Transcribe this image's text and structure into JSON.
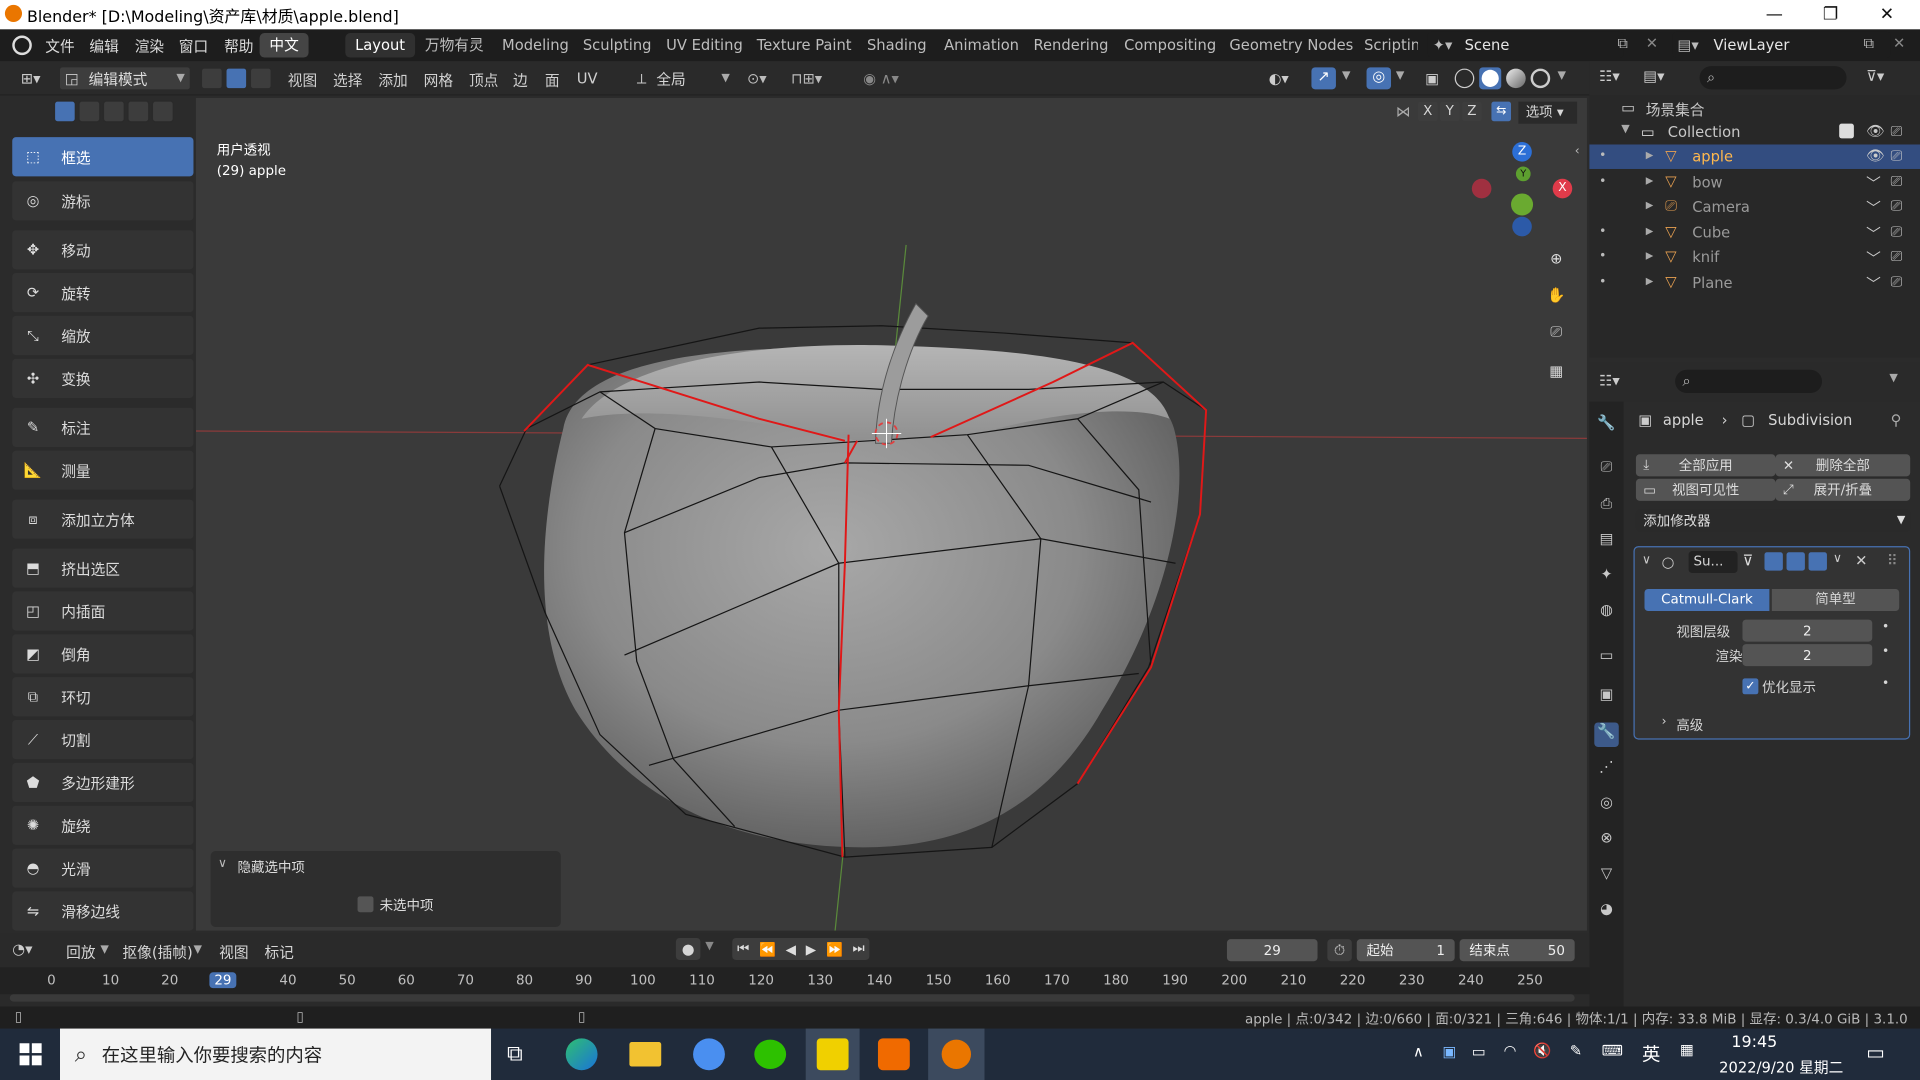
{
  "window": {
    "title": "Blender* [D:\\Modeling\\资产库\\材质\\apple.blend]"
  },
  "menu": {
    "items": [
      "文件",
      "编辑",
      "渲染",
      "窗口",
      "帮助"
    ],
    "lang": "中文"
  },
  "workspaces": [
    "Layout",
    "万物有灵",
    "Modeling",
    "Sculpting",
    "UV Editing",
    "Texture Paint",
    "Shading",
    "Animation",
    "Rendering",
    "Compositing",
    "Geometry Nodes",
    "Scripting"
  ],
  "scene": {
    "name": "Scene",
    "view_layer": "ViewLayer"
  },
  "header": {
    "mode": "编辑模式",
    "menus": [
      "视图",
      "选择",
      "添加",
      "网格",
      "顶点",
      "边",
      "面",
      "UV"
    ],
    "transform": "全局",
    "options": "选项",
    "axes": [
      "X",
      "Y",
      "Z"
    ]
  },
  "tools": [
    "框选",
    "游标",
    "移动",
    "旋转",
    "缩放",
    "变换",
    "标注",
    "测量",
    "添加立方体",
    "挤出选区",
    "内插面",
    "倒角",
    "环切",
    "切割",
    "多边形建形",
    "旋绕",
    "光滑",
    "滑移边线"
  ],
  "viewport": {
    "view_name": "用户透视",
    "object_info": "(29) apple"
  },
  "gizmo": {
    "z": "Z",
    "y": "Y",
    "x": "X"
  },
  "hide_panel": {
    "title": "隐藏选中项",
    "option": "未选中项"
  },
  "outliner": {
    "root": "场景集合",
    "collection": "Collection",
    "objects": [
      "apple",
      "bow",
      "Camera",
      "Cube",
      "knif",
      "Plane"
    ]
  },
  "properties": {
    "breadcrumb_object": "apple",
    "breadcrumb_modifier": "Subdivision",
    "apply_all": "全部应用",
    "delete_all": "删除全部",
    "viewport_vis": "视图可见性",
    "expand_collapse": "展开/折叠",
    "add_modifier": "添加修改器",
    "modifier_name": "Su...",
    "catmull": "Catmull-Clark",
    "simple": "简单型",
    "levels_label": "视图层级",
    "levels_value": "2",
    "render_label": "渲染",
    "render_value": "2",
    "optimal": "优化显示",
    "advanced": "高级"
  },
  "timeline": {
    "menus": [
      "回放",
      "抠像(插帧)",
      "视图",
      "标记"
    ],
    "current_frame": "29",
    "start_label": "起始",
    "start": "1",
    "end_label": "结束点",
    "end": "50",
    "ticks": [
      "0",
      "10",
      "20",
      "29",
      "40",
      "50",
      "60",
      "70",
      "80",
      "90",
      "100",
      "110",
      "120",
      "130",
      "140",
      "150",
      "160",
      "170",
      "180",
      "190",
      "200",
      "210",
      "220",
      "230",
      "240",
      "250"
    ]
  },
  "status": {
    "text": "apple | 点:0/342 | 边:0/660 | 面:0/321 | 三角:646 | 物体:1/1 | 内存: 33.8 MiB | 显存: 0.3/4.0 GiB | 3.1.0"
  },
  "taskbar": {
    "search_placeholder": "在这里输入你要搜索的内容",
    "time": "19:45",
    "date": "2022/9/20 星期二",
    "ime": "英"
  }
}
